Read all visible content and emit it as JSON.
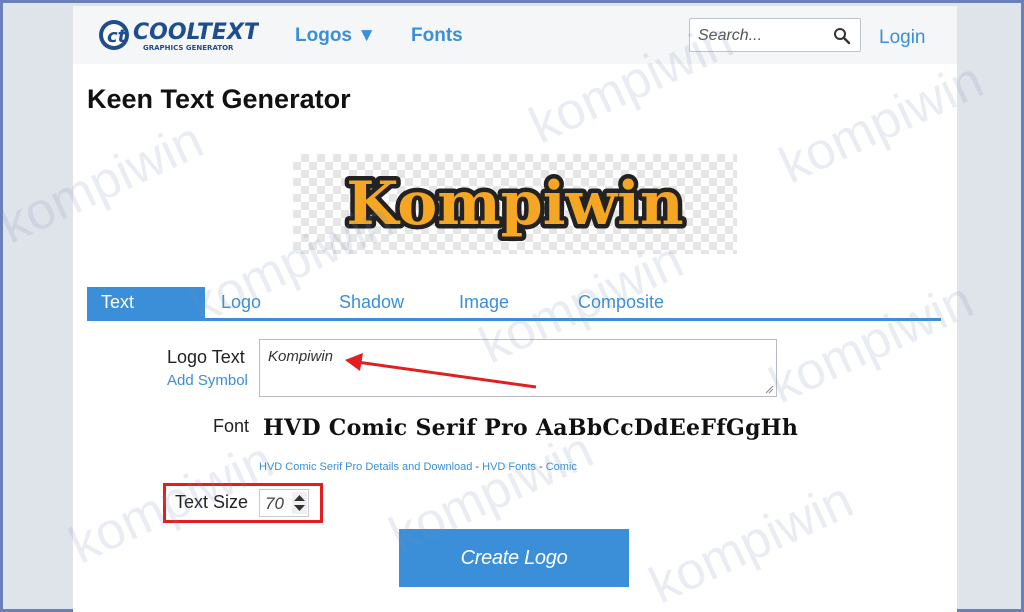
{
  "header": {
    "brand_name": "COOLTEXT",
    "brand_tagline": "GRAPHICS GENERATOR",
    "nav": [
      {
        "label": "Logos ▼"
      },
      {
        "label": "Fonts"
      }
    ],
    "search_placeholder": "Search...",
    "login_label": "Login"
  },
  "page": {
    "title": "Keen Text Generator",
    "preview_text": "Kompiwin"
  },
  "tabs": [
    {
      "label": "Text",
      "active": true
    },
    {
      "label": "Logo"
    },
    {
      "label": "Shadow"
    },
    {
      "label": "Image"
    },
    {
      "label": "Composite"
    }
  ],
  "form": {
    "logo_text_label": "Logo Text",
    "add_symbol_label": "Add Symbol",
    "logo_text_value": "Kompiwin",
    "font_label": "Font",
    "font_preview": "HVD Comic Serif Pro AaBbCcDdEeFfGgHh",
    "font_links": [
      "HVD Comic Serif Pro Details and Download",
      "HVD Fonts",
      "Comic"
    ],
    "font_links_sep": " - ",
    "text_size_label": "Text Size",
    "text_size_value": "70",
    "create_button": "Create Logo"
  },
  "watermark": "kompiwin",
  "colors": {
    "accent": "#3a8fd8",
    "highlight": "#e02020",
    "logo_fill": "#f5a623",
    "logo_outline": "#222222"
  },
  "icons": {
    "search": "search-icon",
    "spinner": "stepper-icon",
    "logo": "cooltext-logo-icon"
  }
}
